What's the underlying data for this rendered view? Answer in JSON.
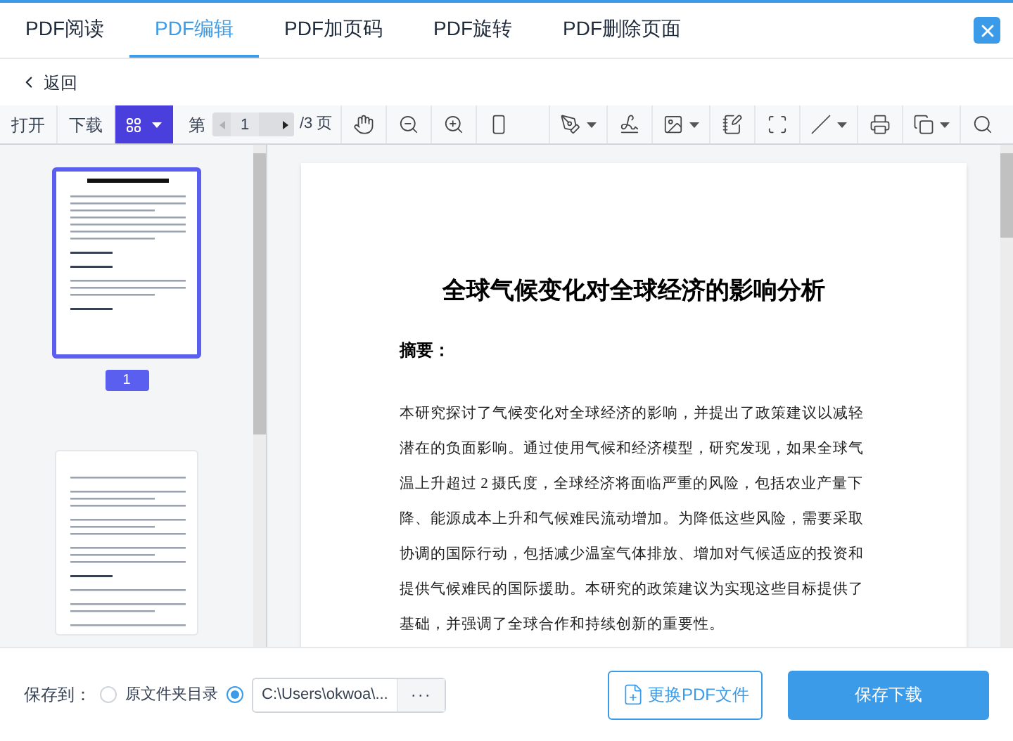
{
  "tabs": [
    {
      "label": "PDF阅读",
      "selected": false
    },
    {
      "label": "PDF编辑",
      "selected": true
    },
    {
      "label": "PDF加页码",
      "selected": false
    },
    {
      "label": "PDF旋转",
      "selected": false
    },
    {
      "label": "PDF删除页面",
      "selected": false
    }
  ],
  "back": "返回",
  "toolbar": {
    "buttons": [
      "打开",
      "下载"
    ],
    "view_menu": {
      "selected": true
    },
    "page": {
      "prefix": "第",
      "value": "1",
      "suffix": "/3 页",
      "prev_disabled": true,
      "next_disabled": false
    },
    "tools": [
      {
        "dropdown": false
      },
      {
        "dropdown": false
      },
      {
        "dropdown": false
      },
      {
        "dropdown": false
      },
      {
        "dropdown": true
      },
      {
        "dropdown": false
      },
      {
        "dropdown": true
      },
      {
        "dropdown": false
      },
      {
        "dropdown": false
      },
      {
        "dropdown": true
      },
      {
        "dropdown": false
      },
      {
        "dropdown": true
      },
      {
        "dropdown": false
      }
    ]
  },
  "thumbnails": [
    {
      "label": "1",
      "selected": true
    },
    {
      "selected": false
    }
  ],
  "document": {
    "title": "全球气候变化对全球经济的影响分析",
    "heading": "摘要：",
    "paragraph": "本研究探讨了气候变化对全球经济的影响，并提出了政策建议以减轻潜在的负面影响。通过使用气候和经济模型，研究发现，如果全球气温上升超过 2 摄氏度，全球经济将面临严重的风险，包括农业产量下降、能源成本上升和气候难民流动增加。为降低这些风险，需要采取协调的国际行动，包括减少温室气体排放、增加对气候适应的投资和提供气候难民的国际援助。本研究的政策建议为实现这些目标提供了基础，并强调了全球合作和持续创新的重要性。"
  },
  "footer": {
    "save_to": "保存到：",
    "options": [
      {
        "kind": "label",
        "label": "原文件夹目录",
        "selected": false
      },
      {
        "kind": "path",
        "value": "C:\\Users\\okwoa\\...",
        "selected": true
      }
    ],
    "browse": "···",
    "change_button": "更换PDF文件",
    "save_button": "保存下载"
  }
}
